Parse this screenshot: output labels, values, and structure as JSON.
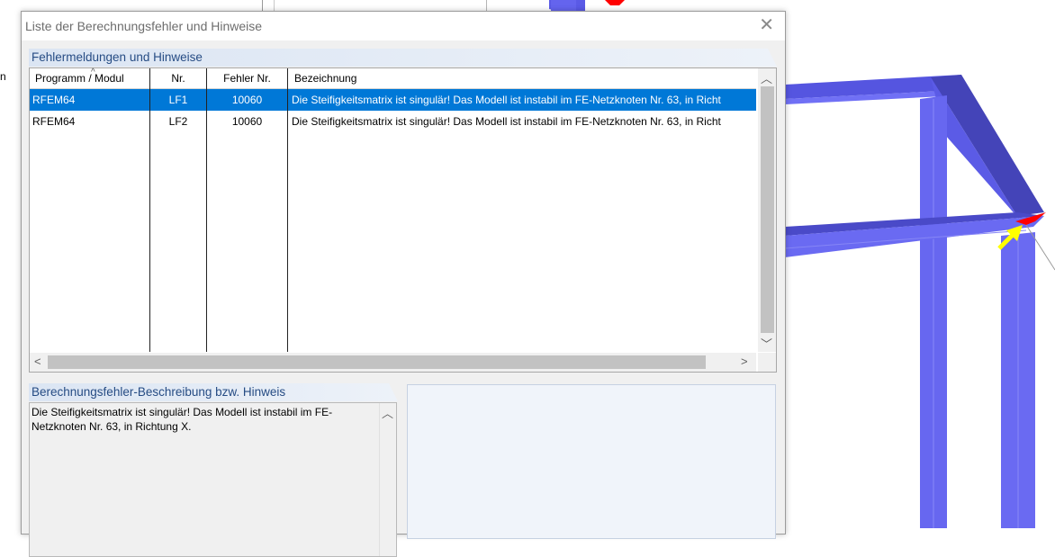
{
  "background": {
    "left_fragment": "n",
    "colors": {
      "frame": "#6a6af2",
      "frame_dark": "#4242b8",
      "support_red": "#ff0000",
      "arrow_yellow": "#ffff00"
    }
  },
  "dialog": {
    "title": "Liste der Berechnungsfehler und Hinweise",
    "close_glyph": "✕",
    "errors_group": {
      "header": "Fehlermeldungen und Hinweise",
      "columns": [
        "Programm / Modul",
        "Nr.",
        "Fehler Nr.",
        "Bezeichnung"
      ],
      "rows": [
        {
          "program": "RFEM64",
          "nr": "LF1",
          "error_no": "10060",
          "description": "Die Steifigkeitsmatrix ist singulär! Das Modell ist instabil  im FE-Netzknoten Nr. 63, in Richt",
          "selected": true
        },
        {
          "program": "RFEM64",
          "nr": "LF2",
          "error_no": "10060",
          "description": "Die Steifigkeitsmatrix ist singulär! Das Modell ist instabil  im FE-Netzknoten Nr. 63, in Richt",
          "selected": false
        }
      ],
      "scroll_up": "︿",
      "scroll_down": "﹀",
      "scroll_left": "<",
      "scroll_right": ">"
    },
    "description_group": {
      "header": "Berechnungsfehler-Beschreibung bzw. Hinweis",
      "text": "Die Steifigkeitsmatrix ist singulär! Das Modell ist instabil  im FE-Netzknoten Nr. 63, in Richtung X."
    },
    "selection_color": "#0078d7",
    "header_text_color": "#264c84"
  }
}
